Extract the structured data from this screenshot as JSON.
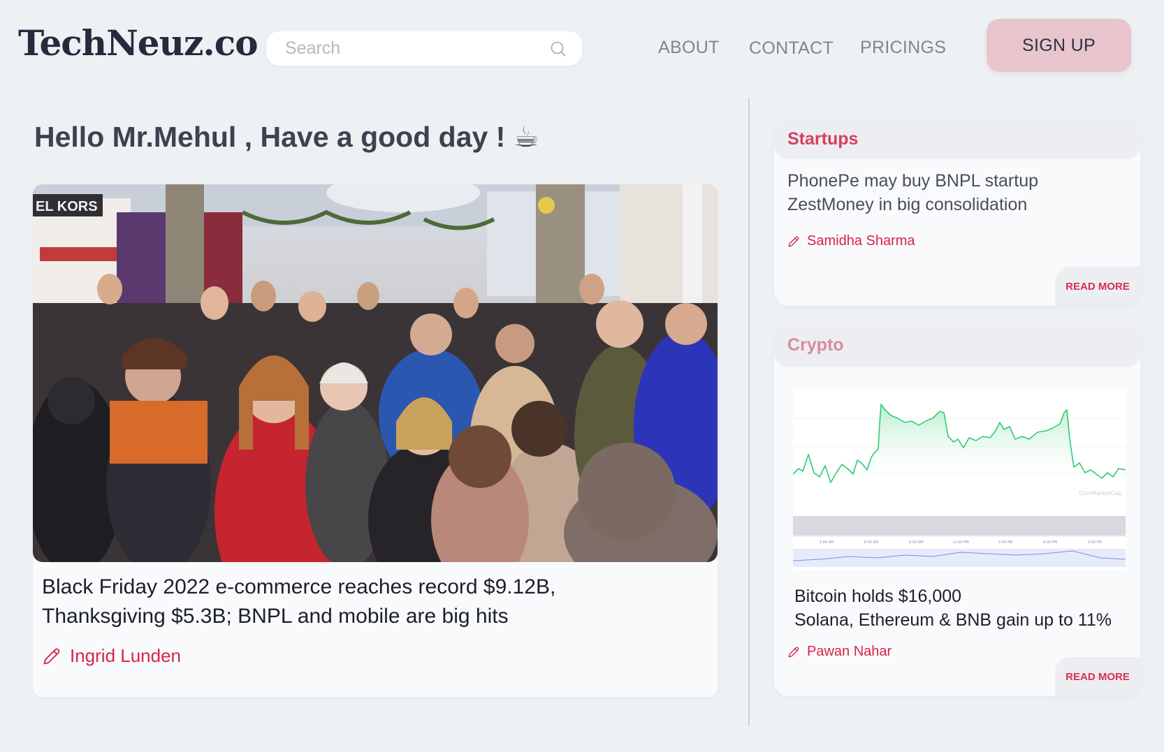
{
  "header": {
    "logo": "TechNeuz.co",
    "search_placeholder": "Search",
    "nav": {
      "about": "ABOUT",
      "contact": "CONTACT",
      "pricings": "PRICINGS"
    },
    "signup": "SIGN UP"
  },
  "greeting": "Hello Mr.Mehul , Have a good day ! ☕",
  "main_article": {
    "headline_line1": "Black Friday 2022 e-commerce reaches record  $9.12B,",
    "headline_line2": "Thanksgiving $5.3B;  BNPL and mobile are big hits",
    "author": "Ingrid Lunden",
    "image_sign": "EL KORS"
  },
  "startups_card": {
    "category": "Startups",
    "headline_line1": "PhonePe may buy BNPL startup",
    "headline_line2": "ZestMoney in big consolidation",
    "author": "Samidha Sharma",
    "read_more": "READ MORE"
  },
  "crypto_card": {
    "category": "Crypto",
    "headline_line1": "Bitcoin holds $16,000",
    "headline_line2": "Solana, Ethereum & BNB gain up to 11%",
    "author": "Pawan Nahar",
    "read_more": "READ MORE",
    "chart_watermark": "CoinMarketCap",
    "chart_times": [
      "3:00 AM",
      "6:00 AM",
      "9:00 AM",
      "12:00 PM",
      "3:00 PM",
      "6:00 PM",
      "9:00 PM"
    ]
  },
  "colors": {
    "accent": "#d6244b",
    "signup_bg": "#e8c5cc",
    "chart_line": "#2ecc71",
    "page_bg": "#eef1f3"
  },
  "icons": {
    "search": "search-icon",
    "pen": "pen-icon"
  }
}
